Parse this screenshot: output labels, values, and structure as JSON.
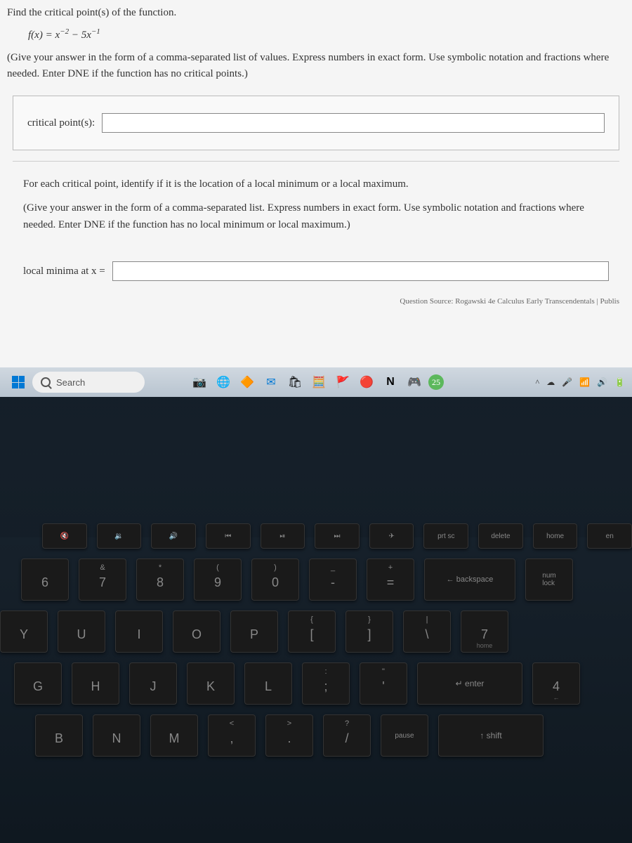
{
  "question": {
    "prompt": "Find the critical point(s) of the function.",
    "formula_html": "f(x) = x⁻² − 5x⁻¹",
    "instructions": "(Give your answer in the form of a comma-separated list of values. Express numbers in exact form. Use symbolic notation and fractions where needed. Enter DNE if the function has no critical points.)",
    "answer_label": "critical point(s):",
    "answer_value": "",
    "sub_prompt1": "For each critical point, identify if it is the location of a local minimum or a local maximum.",
    "sub_prompt2": "(Give your answer in the form of a comma-separated list. Express numbers in exact form. Use symbolic notation and fractions where needed. Enter DNE if the function has no local minimum or local maximum.)",
    "minima_label": "local minima at x =",
    "minima_value": "",
    "source": "Question Source: Rogawski 4e Calculus Early Transcendentals | Publis"
  },
  "taskbar": {
    "search_placeholder": "Search",
    "tray": {
      "chevron": "^",
      "cloud": "☁",
      "mic": "🎤",
      "wifi": "📶",
      "sound": "🔊",
      "battery": "🔋"
    }
  },
  "keys": {
    "fn_row": [
      "🔇",
      "🔉",
      "🔊",
      "⏮",
      "⏯",
      "⏭",
      "✈",
      "prt sc",
      "delete",
      "home",
      "en"
    ],
    "num_row": [
      {
        "t": "",
        "m": "6"
      },
      {
        "t": "&",
        "m": "7"
      },
      {
        "t": "*",
        "m": "8"
      },
      {
        "t": "(",
        "m": "9"
      },
      {
        "t": ")",
        "m": "0"
      },
      {
        "t": "_",
        "m": "-"
      },
      {
        "t": "+",
        "m": "="
      }
    ],
    "backspace": "backspace",
    "numlock": "num\nlock",
    "row2": [
      "Y",
      "U",
      "I",
      "O",
      "P"
    ],
    "row2_brackets": [
      {
        "t": "{",
        "m": "["
      },
      {
        "t": "}",
        "m": "]"
      },
      {
        "t": "|",
        "m": "\\"
      }
    ],
    "numpad7": {
      "m": "7",
      "s": "home"
    },
    "row3": [
      "G",
      "H",
      "J",
      "K",
      "L"
    ],
    "row3_punct": [
      {
        "t": ":",
        "m": ";"
      },
      {
        "t": "\"",
        "m": "'"
      }
    ],
    "enter": "enter",
    "numpad4": {
      "m": "4",
      "s": "←"
    },
    "row4": [
      "B",
      "N",
      "M"
    ],
    "row4_punct": [
      {
        "t": "<",
        "m": ","
      },
      {
        "t": ">",
        "m": "."
      },
      {
        "t": "?",
        "m": "/"
      }
    ],
    "pause": "pause",
    "shift": "↑ shift"
  }
}
